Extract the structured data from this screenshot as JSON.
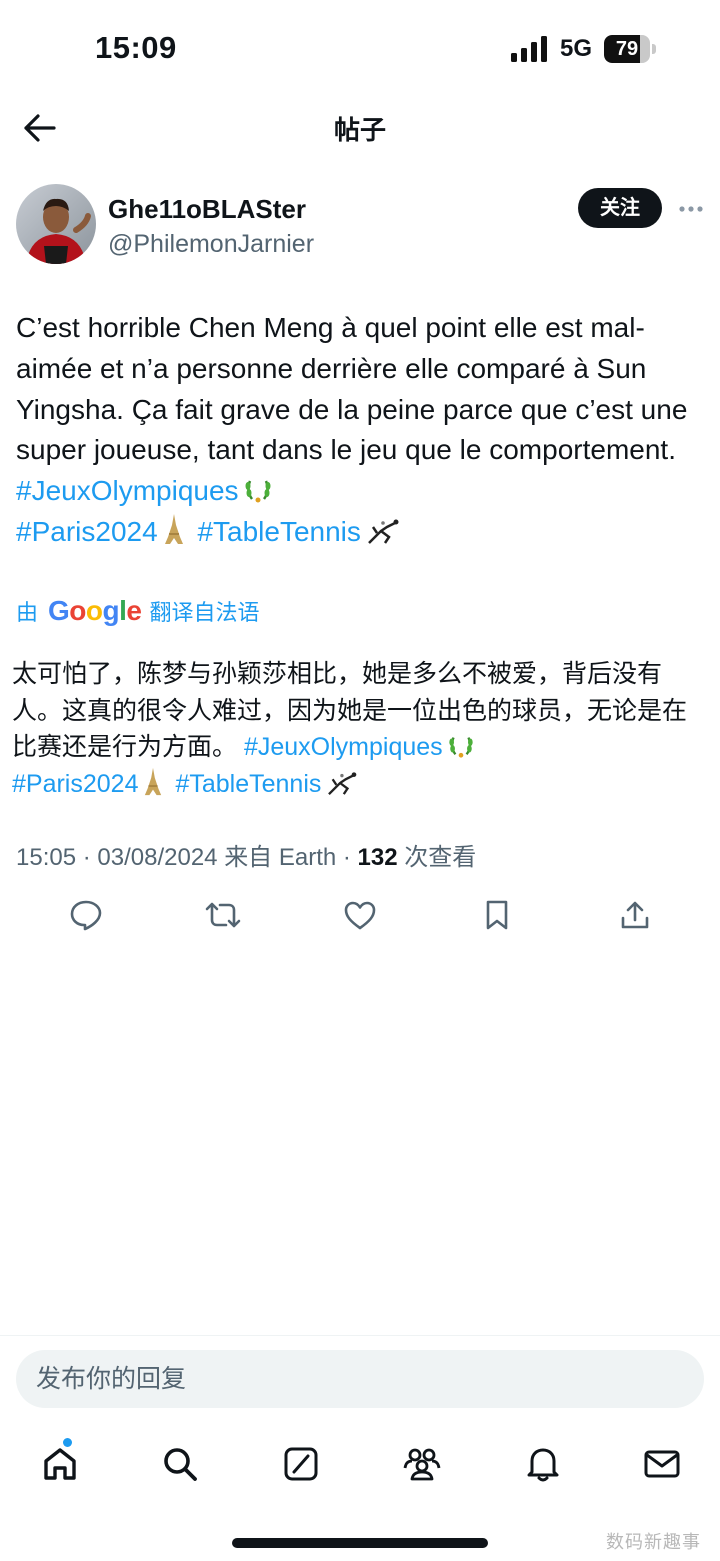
{
  "status_bar": {
    "time": "15:09",
    "network": "5G",
    "battery": "79",
    "battery_level": 0.79
  },
  "nav": {
    "title": "帖子",
    "back_icon": "arrow-left-icon"
  },
  "author": {
    "display_name": "Ghe11oBLASter",
    "handle": "@PhilemonJarnier",
    "follow_label": "关注",
    "more_icon": "more-horizontal-icon"
  },
  "post": {
    "text": "C’est horrible Chen Meng à quel point elle est mal-aimée et n’a personne derrière elle comparé à Sun Yingsha. Ça fait grave de la peine parce que c’est une super joueuse, tant dans le jeu que le comportement.",
    "tags": [
      "#JeuxOlympiques",
      "#Paris2024",
      "#TableTennis"
    ],
    "emoji_icons": [
      "laurel-wreath-icon",
      "eiffel-tower-icon",
      "table-tennis-icon"
    ]
  },
  "translation": {
    "prefix": "由",
    "provider": "Google",
    "suffix": "翻译自法语",
    "text": "太可怕了，陈梦与孙颖莎相比，她是多么不被爱，背后没有人。这真的很令人难过，因为她是一位出色的球员，无论是在比赛还是行为方面。"
  },
  "meta": {
    "time": "15:05",
    "date": "03/08/2024",
    "source": "来自 Earth",
    "views": "132",
    "views_label": "次查看"
  },
  "actions": [
    "reply-icon",
    "retweet-icon",
    "like-icon",
    "bookmark-icon",
    "share-icon"
  ],
  "reply": {
    "placeholder": "发布你的回复"
  },
  "tabs": [
    "home-icon",
    "search-icon",
    "grok-icon",
    "communities-icon",
    "notifications-icon",
    "messages-icon"
  ],
  "watermark": "数码新趣事",
  "colors": {
    "accent": "#1d9bf0",
    "text": "#0f1419",
    "secondary": "#536471"
  }
}
